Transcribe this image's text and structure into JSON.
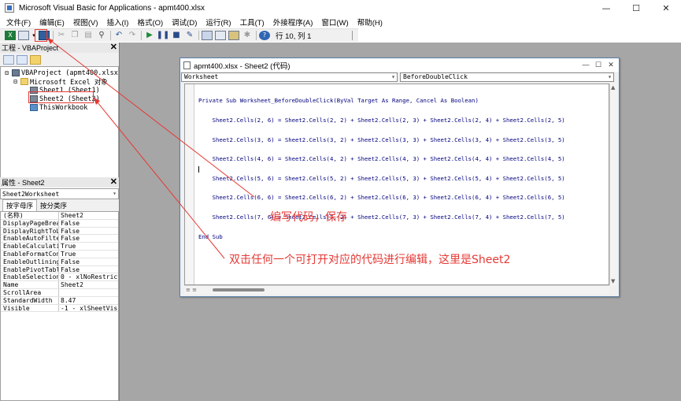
{
  "window": {
    "title": "Microsoft Visual Basic for Applications - apmt400.xlsx",
    "controls": [
      "—",
      "☐",
      "✕"
    ]
  },
  "menu": [
    "文件(F)",
    "编辑(E)",
    "视图(V)",
    "插入(I)",
    "格式(O)",
    "调试(D)",
    "运行(R)",
    "工具(T)",
    "外接程序(A)",
    "窗口(W)",
    "帮助(H)"
  ],
  "toolbar": {
    "position_label": "行 10, 列 1",
    "save_tooltip": "保存"
  },
  "project_pane": {
    "title": "工程 - VBAProject",
    "close": "✕",
    "tree": {
      "project": "VBAProject (apmt400.xlsx)",
      "folder": "Microsoft Excel 对象",
      "items": [
        "Sheet1 (Sheet1)",
        "Sheet2 (Sheet2)",
        "ThisWorkbook"
      ]
    }
  },
  "properties_pane": {
    "title": "属性 - Sheet2",
    "close": "✕",
    "object_name": "Sheet2",
    "object_type": "Worksheet",
    "tabs": [
      "按字母序",
      "按分类序"
    ],
    "rows": [
      {
        "name": "(名称)",
        "value": "Sheet2"
      },
      {
        "name": "DisplayPageBreak",
        "value": "False"
      },
      {
        "name": "DisplayRightToLe",
        "value": "False"
      },
      {
        "name": "EnableAutoFilter",
        "value": "False"
      },
      {
        "name": "EnableCalculatio",
        "value": "True"
      },
      {
        "name": "EnableFormatCond",
        "value": "True"
      },
      {
        "name": "EnableOutlining",
        "value": "False"
      },
      {
        "name": "EnablePivotTable",
        "value": "False"
      },
      {
        "name": "EnableSelection",
        "value": "0 - xlNoRestrict"
      },
      {
        "name": "Name",
        "value": "Sheet2"
      },
      {
        "name": "ScrollArea",
        "value": ""
      },
      {
        "name": "StandardWidth",
        "value": "8.47"
      },
      {
        "name": "Visible",
        "value": "-1 - xlSheetVisi"
      }
    ]
  },
  "code_window": {
    "title": "apmt400.xlsx - Sheet2 (代码)",
    "object_combo": "Worksheet",
    "procedure_combo": "BeforeDoubleClick",
    "lines": [
      "Private Sub Worksheet_BeforeDoubleClick(ByVal Target As Range, Cancel As Boolean)",
      "    Sheet2.Cells(2, 6) = Sheet2.Cells(2, 2) + Sheet2.Cells(2, 3) + Sheet2.Cells(2, 4) + Sheet2.Cells(2, 5)",
      "    Sheet2.Cells(3, 6) = Sheet2.Cells(3, 2) + Sheet2.Cells(3, 3) + Sheet2.Cells(3, 4) + Sheet2.Cells(3, 5)",
      "    Sheet2.Cells(4, 6) = Sheet2.Cells(4, 2) + Sheet2.Cells(4, 3) + Sheet2.Cells(4, 4) + Sheet2.Cells(4, 5)",
      "    Sheet2.Cells(5, 6) = Sheet2.Cells(5, 2) + Sheet2.Cells(5, 3) + Sheet2.Cells(5, 4) + Sheet2.Cells(5, 5)",
      "    Sheet2.Cells(6, 6) = Sheet2.Cells(6, 2) + Sheet2.Cells(6, 3) + Sheet2.Cells(6, 4) + Sheet2.Cells(6, 5)",
      "    Sheet2.Cells(7, 6) = Sheet2.Cells(7, 2) + Sheet2.Cells(7, 3) + Sheet2.Cells(7, 4) + Sheet2.Cells(7, 5)",
      "End Sub"
    ]
  },
  "annotations": {
    "save_note": "编写代码，保存",
    "edit_note": "双击任何一个可打开对应的代码进行编辑，这里是Sheet2",
    "color": "#e53935"
  },
  "colors": {
    "workspace": "#a6a6a6",
    "code_keyword": "#00007f",
    "highlight": "#e53935"
  }
}
